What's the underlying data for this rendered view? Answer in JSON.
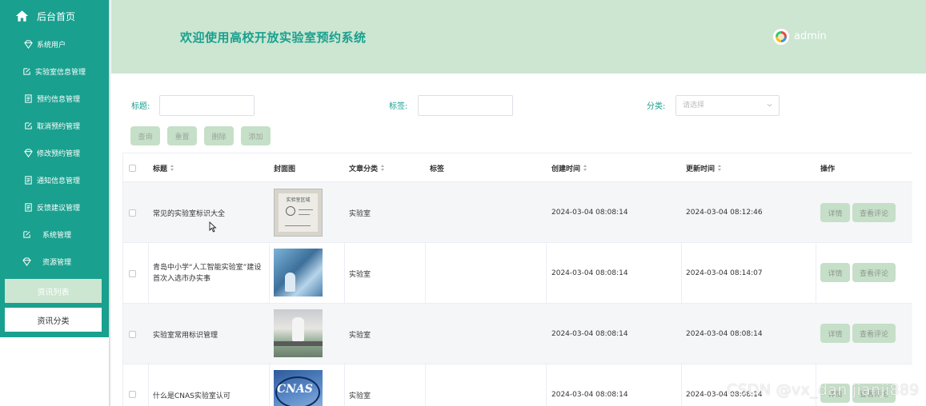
{
  "sidebar": {
    "home_label": "后台首页",
    "items": [
      {
        "label": "系统用户",
        "icon": "diamond-icon"
      },
      {
        "label": "实验室信息管理",
        "icon": "edit-icon"
      },
      {
        "label": "预约信息管理",
        "icon": "document-icon"
      },
      {
        "label": "取消预约管理",
        "icon": "edit-icon"
      },
      {
        "label": "修改预约管理",
        "icon": "diamond-icon"
      },
      {
        "label": "通知信息管理",
        "icon": "document-icon"
      },
      {
        "label": "反馈建议管理",
        "icon": "document-icon"
      },
      {
        "label": "系统管理",
        "icon": "edit-icon"
      },
      {
        "label": "资源管理",
        "icon": "diamond-icon"
      }
    ],
    "sub_items": [
      {
        "label": "资讯列表",
        "active": true
      },
      {
        "label": "资讯分类",
        "active": false
      }
    ]
  },
  "header": {
    "title": "欢迎使用高校开放实验室预约系统",
    "username": "admin"
  },
  "search": {
    "title_label": "标题:",
    "tag_label": "标签:",
    "category_label": "分类:",
    "category_placeholder": "请选择"
  },
  "actions": {
    "query": "查询",
    "reset": "重置",
    "delete": "删除",
    "add": "添加"
  },
  "table": {
    "columns": [
      "标题",
      "封面图",
      "文章分类",
      "标签",
      "创建时间",
      "更新时间",
      "操作"
    ],
    "rows": [
      {
        "title": "常见的实验室标识大全",
        "category": "实验室",
        "tag": "",
        "created": "2024-03-04 08:08:14",
        "updated": "2024-03-04 08:12:46",
        "cover_text": "实验室区域"
      },
      {
        "title": "青岛中小学“人工智能实验室”建设首次入选市办实事",
        "category": "实验室",
        "tag": "",
        "created": "2024-03-04 08:08:14",
        "updated": "2024-03-04 08:14:07"
      },
      {
        "title": "实验室常用标识管理",
        "category": "实验室",
        "tag": "",
        "created": "2024-03-04 08:08:14",
        "updated": "2024-03-04 08:08:14"
      },
      {
        "title": "什么是CNAS实验室认可",
        "category": "实验室",
        "tag": "",
        "created": "2024-03-04 08:08:14",
        "updated": "2024-03-04 08:08:14",
        "cover_text": "CNAS"
      }
    ],
    "row_actions": {
      "detail": "详情",
      "comments": "查看评论"
    }
  },
  "watermark": "CSDN @vx_dan jianji889",
  "colors": {
    "sidebar": "#1aa08f",
    "header": "#cce6d1",
    "accent": "#1aa08f",
    "button": "#c6dfc8"
  }
}
